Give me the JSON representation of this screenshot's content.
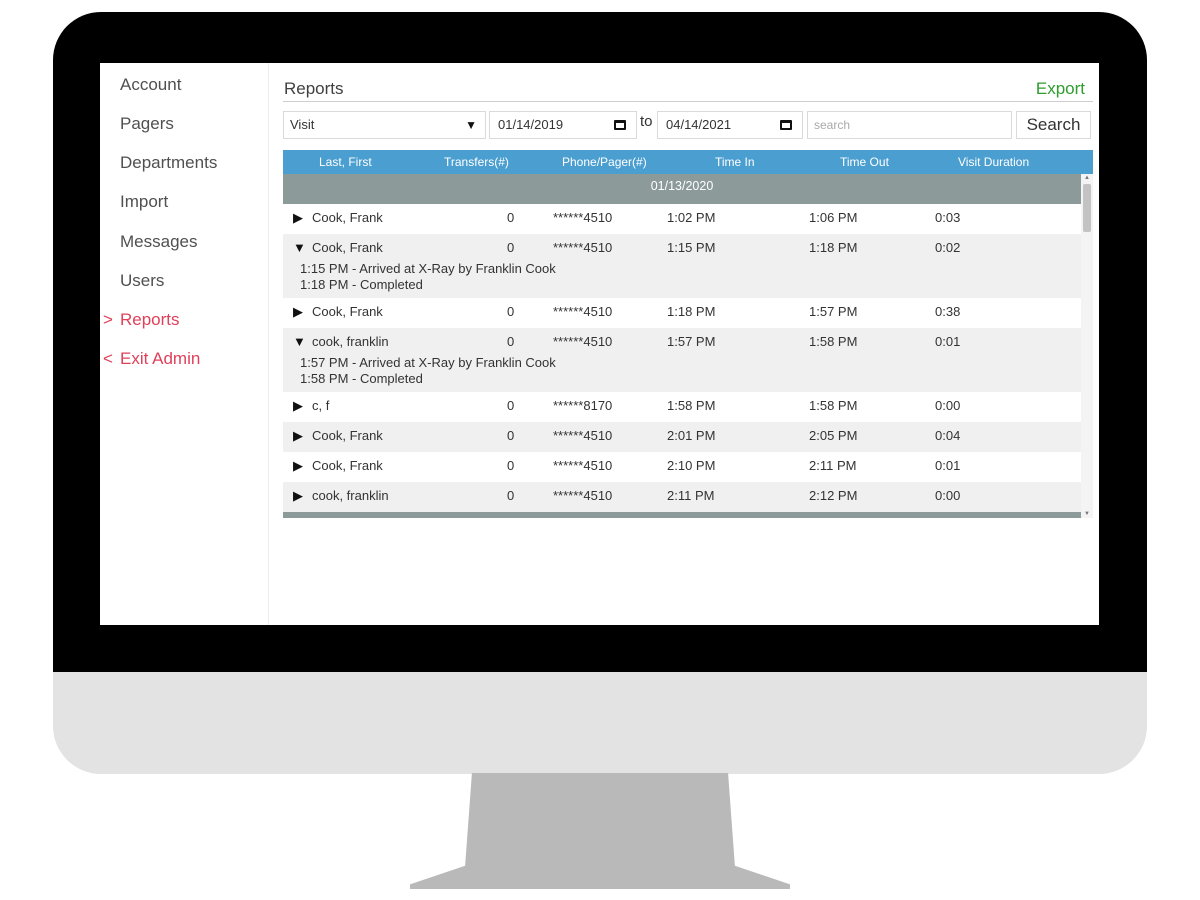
{
  "sidebar": {
    "items": [
      {
        "label": "Account"
      },
      {
        "label": "Pagers"
      },
      {
        "label": "Departments"
      },
      {
        "label": "Import"
      },
      {
        "label": "Messages"
      },
      {
        "label": "Users"
      },
      {
        "label": "Reports",
        "marker": ">"
      },
      {
        "label": "Exit Admin",
        "marker": "<"
      }
    ],
    "active_color": "#e0405a"
  },
  "header": {
    "title": "Reports",
    "export_label": "Export",
    "export_color": "#2e9c2e"
  },
  "filters": {
    "type_value": "Visit",
    "from_date": "01/14/2019",
    "to_label": "to",
    "to_date": "04/14/2021",
    "search_placeholder": "search",
    "search_button": "Search"
  },
  "table": {
    "columns": [
      "Last, First",
      "Transfers(#)",
      "Phone/Pager(#)",
      "Time In",
      "Time Out",
      "Visit Duration"
    ],
    "header_color": "#4b9ed0",
    "group_date": "01/13/2020",
    "rows": [
      {
        "name": "Cook, Frank",
        "transfers": "0",
        "phone": "******4510",
        "time_in": "1:02 PM",
        "time_out": "1:06 PM",
        "duration": "0:03",
        "expanded": false
      },
      {
        "name": "Cook, Frank",
        "transfers": "0",
        "phone": "******4510",
        "time_in": "1:15 PM",
        "time_out": "1:18 PM",
        "duration": "0:02",
        "expanded": true,
        "details": [
          "1:15 PM - Arrived at X-Ray by Franklin Cook",
          "1:18 PM - Completed"
        ]
      },
      {
        "name": "Cook, Frank",
        "transfers": "0",
        "phone": "******4510",
        "time_in": "1:18 PM",
        "time_out": "1:57 PM",
        "duration": "0:38",
        "expanded": false
      },
      {
        "name": "cook, franklin",
        "transfers": "0",
        "phone": "******4510",
        "time_in": "1:57 PM",
        "time_out": "1:58 PM",
        "duration": "0:01",
        "expanded": true,
        "details": [
          "1:57 PM - Arrived at X-Ray by Franklin Cook",
          "1:58 PM - Completed"
        ]
      },
      {
        "name": "c, f",
        "transfers": "0",
        "phone": "******8170",
        "time_in": "1:58 PM",
        "time_out": "1:58 PM",
        "duration": "0:00",
        "expanded": false
      },
      {
        "name": "Cook, Frank",
        "transfers": "0",
        "phone": "******4510",
        "time_in": "2:01 PM",
        "time_out": "2:05 PM",
        "duration": "0:04",
        "expanded": false
      },
      {
        "name": "Cook, Frank",
        "transfers": "0",
        "phone": "******4510",
        "time_in": "2:10 PM",
        "time_out": "2:11 PM",
        "duration": "0:01",
        "expanded": false
      },
      {
        "name": "cook, franklin",
        "transfers": "0",
        "phone": "******4510",
        "time_in": "2:11 PM",
        "time_out": "2:12 PM",
        "duration": "0:00",
        "expanded": false
      }
    ]
  },
  "icons": {
    "collapsed": "triangle-right-icon",
    "expanded": "triangle-down-icon",
    "calendar": "calendar-icon",
    "dropdown": "caret-down-icon"
  }
}
